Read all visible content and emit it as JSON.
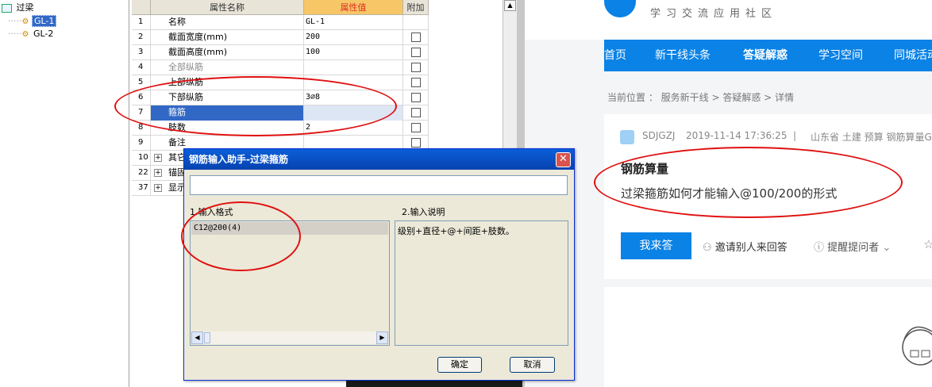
{
  "tree": {
    "root": "过梁",
    "items": [
      "GL-1",
      "GL-2"
    ]
  },
  "grid": {
    "headers": [
      "属性名称",
      "属性值",
      "附加"
    ],
    "rows": [
      {
        "num": "1",
        "name": "名称",
        "value": "GL-1",
        "check": false
      },
      {
        "num": "2",
        "name": "截面宽度(mm)",
        "value": "200",
        "check": true
      },
      {
        "num": "3",
        "name": "截面高度(mm)",
        "value": "100",
        "check": true
      },
      {
        "num": "4",
        "name": "全部纵筋",
        "value": "",
        "check": true
      },
      {
        "num": "5",
        "name": "上部纵筋",
        "value": "",
        "check": true
      },
      {
        "num": "6",
        "name": "下部纵筋",
        "value": "3⌀8",
        "check": true
      },
      {
        "num": "7",
        "name": "箍筋",
        "value": "",
        "check": true
      },
      {
        "num": "8",
        "name": "肢数",
        "value": "2",
        "check": true
      },
      {
        "num": "9",
        "name": "备注",
        "value": "",
        "check": true
      },
      {
        "num": "10",
        "name": "其它",
        "value": "",
        "check": false
      },
      {
        "num": "22",
        "name": "锚固",
        "value": "",
        "check": false
      },
      {
        "num": "37",
        "name": "显示",
        "value": "",
        "check": false
      }
    ]
  },
  "dialog": {
    "title": "钢筋输入助手-过梁箍筋",
    "input_value": "",
    "format_label": "1.输入格式",
    "desc_label": "2.输入说明",
    "format_item": "C12@200(4)",
    "desc_text": "级别+直径+@+间距+肢数。",
    "ok": "确定",
    "cancel": "取消"
  },
  "web": {
    "brand_sub": "学习交流应用社区",
    "nav": [
      "首页",
      "新干线头条",
      "答疑解惑",
      "学习空间",
      "同城活动"
    ],
    "breadcrumb": "当前位置 ： 服务新干线 > 答疑解惑 > 详情",
    "user": "SDJGZJ",
    "time": "2019-11-14 17:36:25",
    "sep": "|",
    "tags": "山东省  土建  预算  钢筋算量GGJ",
    "topic": "钢筋算量",
    "question": "过梁箍筋如何才能输入@100/200的形式",
    "answer_btn": "我来答",
    "invite": "邀请别人来回答",
    "remind": "提醒提问者",
    "accent": "#0a82e6"
  }
}
